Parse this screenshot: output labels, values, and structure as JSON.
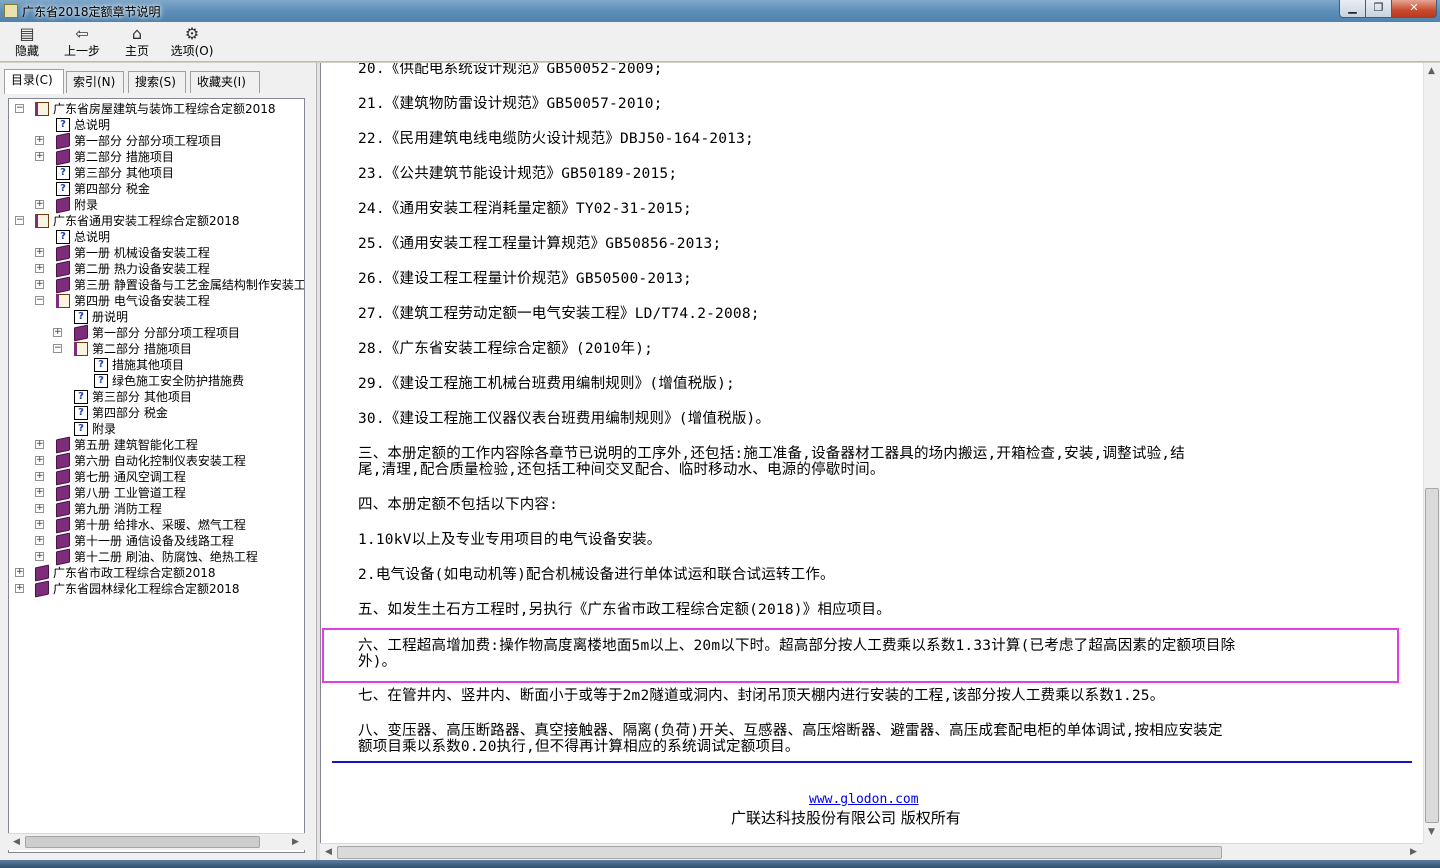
{
  "window": {
    "title": "广东省2018定额章节说明"
  },
  "toolbar": {
    "hide": "隐藏",
    "back": "上一步",
    "home": "主页",
    "options": "选项(O)"
  },
  "tabs": [
    "目录(C)",
    "索引(N)",
    "搜索(S)",
    "收藏夹(I)"
  ],
  "tree": [
    {
      "exp": "−",
      "icon": "bookopen",
      "label": "广东省房屋建筑与装饰工程综合定额2018",
      "level": 0
    },
    {
      "exp": "",
      "icon": "q",
      "label": "总说明",
      "level": 1
    },
    {
      "exp": "+",
      "icon": "book",
      "label": "第一部分 分部分项工程项目",
      "level": 1
    },
    {
      "exp": "+",
      "icon": "book",
      "label": "第二部分 措施项目",
      "level": 1
    },
    {
      "exp": "",
      "icon": "q",
      "label": "第三部分 其他项目",
      "level": 1
    },
    {
      "exp": "",
      "icon": "q",
      "label": "第四部分 税金",
      "level": 1
    },
    {
      "exp": "+",
      "icon": "book",
      "label": "附录",
      "level": 1
    },
    {
      "exp": "−",
      "icon": "bookopen",
      "label": "广东省通用安装工程综合定额2018",
      "level": 0
    },
    {
      "exp": "",
      "icon": "q",
      "label": "总说明",
      "level": 1
    },
    {
      "exp": "+",
      "icon": "book",
      "label": "第一册 机械设备安装工程",
      "level": 1
    },
    {
      "exp": "+",
      "icon": "book",
      "label": "第二册 热力设备安装工程",
      "level": 1
    },
    {
      "exp": "+",
      "icon": "book",
      "label": "第三册 静置设备与工艺金属结构制作安装工",
      "level": 1
    },
    {
      "exp": "−",
      "icon": "bookopen",
      "label": "第四册 电气设备安装工程",
      "level": 1
    },
    {
      "exp": "",
      "icon": "q",
      "label": "册说明",
      "level": 2
    },
    {
      "exp": "+",
      "icon": "book",
      "label": "第一部分 分部分项工程项目",
      "level": 2
    },
    {
      "exp": "−",
      "icon": "bookopen",
      "label": "第二部分 措施项目",
      "level": 2
    },
    {
      "exp": "",
      "icon": "q",
      "label": "措施其他项目",
      "level": 3
    },
    {
      "exp": "",
      "icon": "q",
      "label": "绿色施工安全防护措施费",
      "level": 3
    },
    {
      "exp": "",
      "icon": "q",
      "label": "第三部分 其他项目",
      "level": 2
    },
    {
      "exp": "",
      "icon": "q",
      "label": "第四部分 税金",
      "level": 2
    },
    {
      "exp": "",
      "icon": "q",
      "label": "附录",
      "level": 2
    },
    {
      "exp": "+",
      "icon": "book",
      "label": "第五册 建筑智能化工程",
      "level": 1
    },
    {
      "exp": "+",
      "icon": "book",
      "label": "第六册 自动化控制仪表安装工程",
      "level": 1
    },
    {
      "exp": "+",
      "icon": "book",
      "label": "第七册 通风空调工程",
      "level": 1
    },
    {
      "exp": "+",
      "icon": "book",
      "label": "第八册 工业管道工程",
      "level": 1
    },
    {
      "exp": "+",
      "icon": "book",
      "label": "第九册 消防工程",
      "level": 1
    },
    {
      "exp": "+",
      "icon": "book",
      "label": "第十册 给排水、采暖、燃气工程",
      "level": 1
    },
    {
      "exp": "+",
      "icon": "book",
      "label": "第十一册 通信设备及线路工程",
      "level": 1
    },
    {
      "exp": "+",
      "icon": "book",
      "label": "第十二册 刷油、防腐蚀、绝热工程",
      "level": 1
    },
    {
      "exp": "+",
      "icon": "book",
      "label": "广东省市政工程综合定额2018",
      "level": 0
    },
    {
      "exp": "+",
      "icon": "book",
      "label": "广东省园林绿化工程综合定额2018",
      "level": 0
    }
  ],
  "content": {
    "lines": [
      "20.《供配电系统设计规范》GB50052-2009;",
      "21.《建筑物防雷设计规范》GB50057-2010;",
      "22.《民用建筑电线电缆防火设计规范》DBJ50-164-2013;",
      "23.《公共建筑节能设计规范》GB50189-2015;",
      "24.《通用安装工程消耗量定额》TY02-31-2015;",
      "25.《通用安装工程工程量计算规范》GB50856-2013;",
      "26.《建设工程工程量计价规范》GB50500-2013;",
      "27.《建筑工程劳动定额一电气安装工程》LD/T74.2-2008;",
      "28.《广东省安装工程综合定额》(2010年);",
      "29.《建设工程施工机械台班费用编制规则》(增值税版);",
      "30.《建设工程施工仪器仪表台班费用编制规则》(增值税版)。"
    ],
    "para_3_a": "三、本册定额的工作内容除各章节已说明的工序外,还包括:施工准备,设备器材工器具的场内搬运,开箱检查,安装,调整试验,结",
    "para_3_b": "尾,清理,配合质量检验,还包括工种间交叉配合、临时移动水、电源的停歇时间。",
    "para_4": "四、本册定额不包括以下内容:",
    "para_4_1": "1.10kV以上及专业专用项目的电气设备安装。",
    "para_4_2": "2.电气设备(如电动机等)配合机械设备进行单体试运和联合试运转工作。",
    "para_5": "五、如发生土石方工程时,另执行《广东省市政工程综合定额(2018)》相应项目。",
    "para_6_a": "六、工程超高增加费:操作物高度离楼地面5m以上、20m以下时。超高部分按人工费乘以系数1.33计算(已考虑了超高因素的定额项目除",
    "para_6_b": "外)。",
    "para_7": "七、在管井内、竖井内、断面小于或等于2m2隧道或洞内、封闭吊顶天棚内进行安装的工程,该部分按人工费乘以系数1.25。",
    "para_8_a": "八、变压器、高压断路器、真空接触器、隔离(负荷)开关、互感器、高压熔断器、避雷器、高压成套配电柜的单体调试,按相应安装定",
    "para_8_b": "额项目乘以系数0.20执行,但不得再计算相应的系统调试定额项目。",
    "footer_link": "www.glodon.com",
    "footer_copy": "广联达科技股份有限公司 版权所有"
  },
  "colors": {
    "highlight": "#e040e0",
    "divider": "#1414c8",
    "link": "#0000ee"
  }
}
